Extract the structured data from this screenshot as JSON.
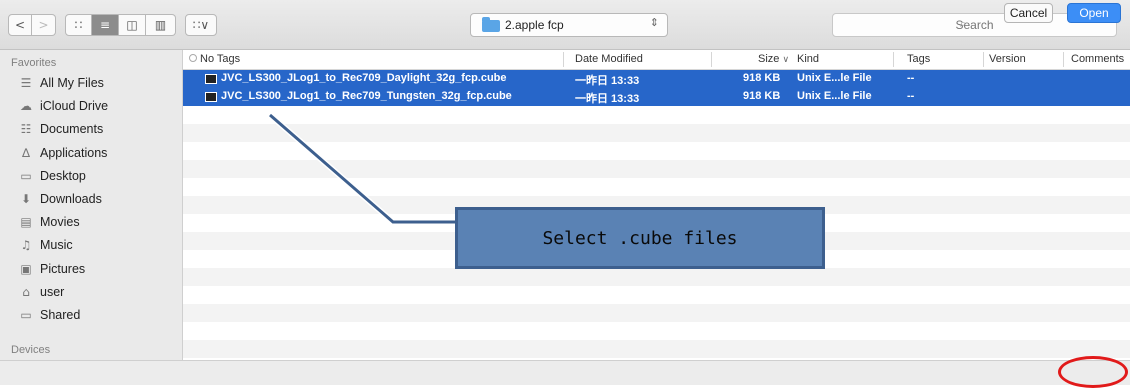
{
  "toolbar": {
    "back_glyph": "<",
    "forward_glyph": ">",
    "view_icon_glyph": "∷",
    "view_list_glyph": "≡",
    "view_columns_glyph": "◫",
    "view_coverflow_glyph": "▥",
    "arrange_glyph": "∷∨",
    "location": "2.apple fcp",
    "location_arrows": "⇕",
    "search_placeholder": "Search",
    "search_glyph": "⌕"
  },
  "sidebar": {
    "favorites_heading": "Favorites",
    "items": [
      {
        "label": "All My Files",
        "icon": "all-files-icon",
        "glyph": "☰"
      },
      {
        "label": "iCloud Drive",
        "icon": "cloud-icon",
        "glyph": "☁"
      },
      {
        "label": "Documents",
        "icon": "documents-icon",
        "glyph": "☷"
      },
      {
        "label": "Applications",
        "icon": "applications-icon",
        "glyph": "∆"
      },
      {
        "label": "Desktop",
        "icon": "desktop-icon",
        "glyph": "▭"
      },
      {
        "label": "Downloads",
        "icon": "downloads-icon",
        "glyph": "⬇"
      },
      {
        "label": "Movies",
        "icon": "movies-icon",
        "glyph": "▤"
      },
      {
        "label": "Music",
        "icon": "music-icon",
        "glyph": "♫"
      },
      {
        "label": "Pictures",
        "icon": "pictures-icon",
        "glyph": "▣"
      },
      {
        "label": "user",
        "icon": "home-icon",
        "glyph": "⌂"
      },
      {
        "label": "Shared",
        "icon": "shared-folder-icon",
        "glyph": "▭"
      }
    ],
    "devices_heading": "Devices"
  },
  "columns": {
    "name": "No Tags",
    "date": "Date Modified",
    "size": "Size",
    "size_sort_glyph": "∨",
    "kind": "Kind",
    "tags": "Tags",
    "version": "Version",
    "comments": "Comments"
  },
  "files": [
    {
      "name": "JVC_LS300_JLog1_to_Rec709_Daylight_32g_fcp.cube",
      "date": "一昨日 13:33",
      "size": "918 KB",
      "kind": "Unix E...le File",
      "tags": "--"
    },
    {
      "name": "JVC_LS300_JLog1_to_Rec709_Tungsten_32g_fcp.cube",
      "date": "一昨日 13:33",
      "size": "918 KB",
      "kind": "Unix E...le File",
      "tags": "--"
    }
  ],
  "buttons": {
    "cancel": "Cancel",
    "open": "Open"
  },
  "annotation": {
    "text": "Select .cube files"
  },
  "colors": {
    "selection": "#2766c9",
    "open_button": "#3c8ef6",
    "highlight_circle": "#e11a1a",
    "callout_fill": "#5a82b4"
  }
}
